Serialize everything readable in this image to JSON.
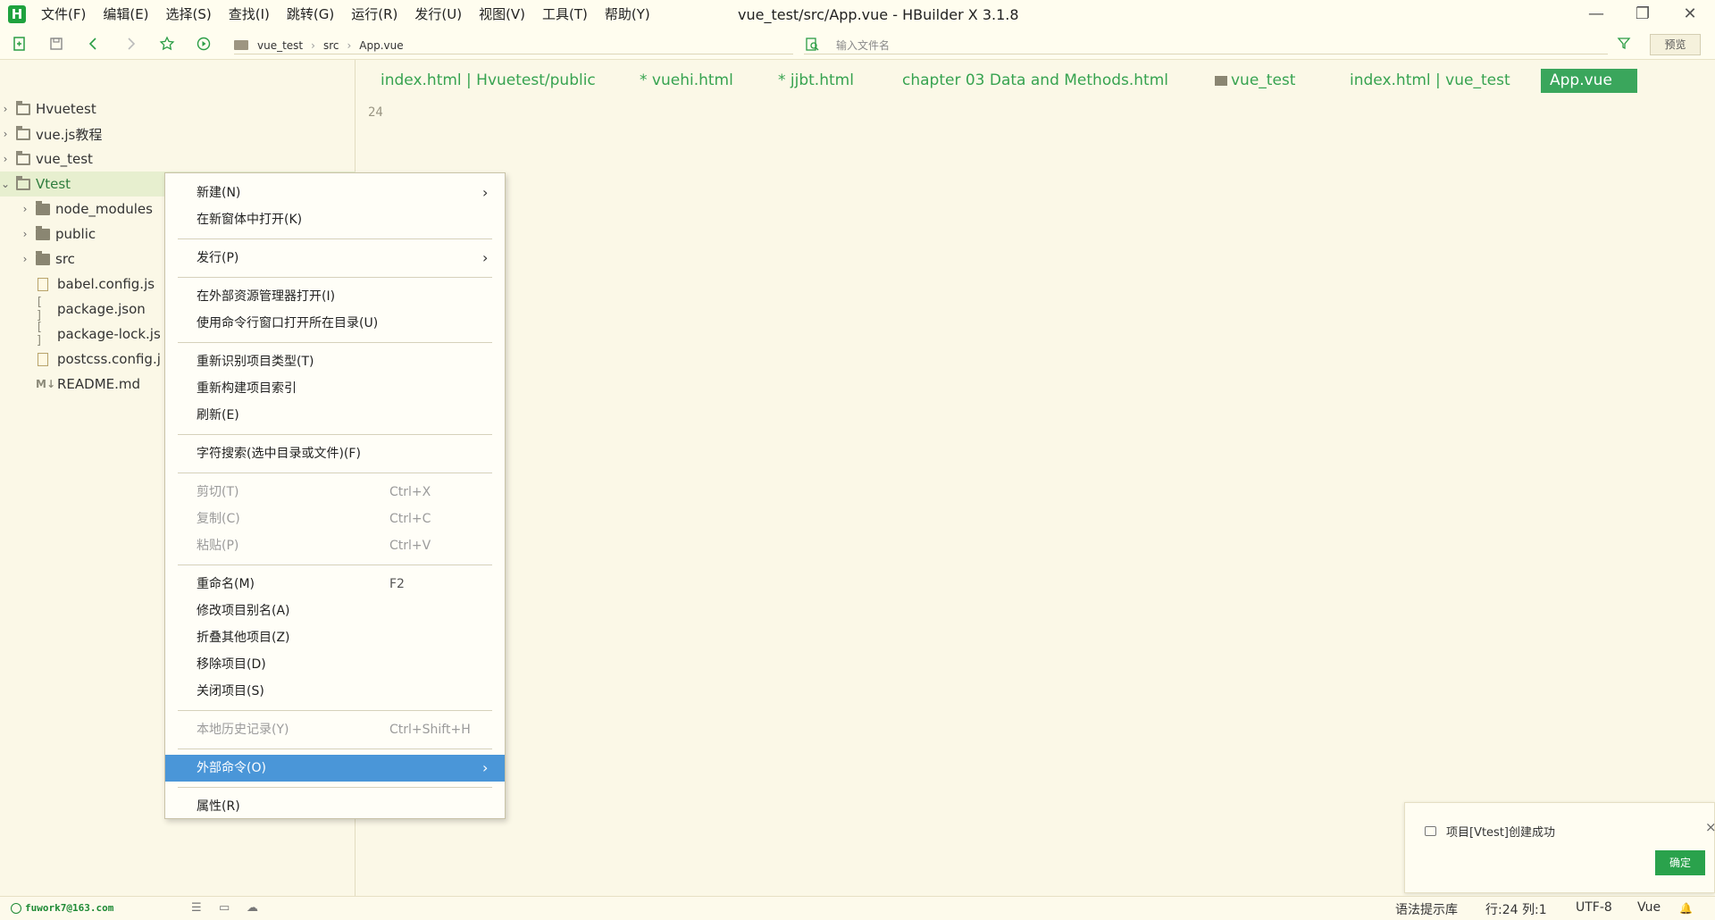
{
  "app": {
    "window_title": "vue_test/src/App.vue - HBuilder X 3.1.8",
    "logo_letter": "H"
  },
  "menu": [
    "文件(F)",
    "编辑(E)",
    "选择(S)",
    "查找(I)",
    "跳转(G)",
    "运行(R)",
    "发行(U)",
    "视图(V)",
    "工具(T)",
    "帮助(Y)"
  ],
  "window_controls": {
    "minimize": "—",
    "maximize": "❐",
    "close": "✕"
  },
  "toolbar": {
    "breadcrumb": [
      "vue_test",
      "src",
      "App.vue"
    ],
    "breadcrumb_sep": "›",
    "file_search_placeholder": "输入文件名",
    "preview_label": "预览"
  },
  "project_tree": [
    {
      "label": "Hvuetest",
      "arrow": "›",
      "type": "project"
    },
    {
      "label": "vue.js教程",
      "arrow": "›",
      "type": "project"
    },
    {
      "label": "vue_test",
      "arrow": "›",
      "type": "project"
    },
    {
      "label": "Vtest",
      "arrow": "⌄",
      "type": "project",
      "selected": true
    },
    {
      "label": "node_modules",
      "arrow": "›",
      "type": "folder"
    },
    {
      "label": "public",
      "arrow": "›",
      "type": "folder"
    },
    {
      "label": "src",
      "arrow": "›",
      "type": "folder"
    },
    {
      "label": "babel.config.js",
      "arrow": "",
      "type": "js"
    },
    {
      "label": "package.json",
      "arrow": "",
      "type": "json"
    },
    {
      "label": "package-lock.js",
      "arrow": "",
      "type": "json"
    },
    {
      "label": "postcss.config.j",
      "arrow": "",
      "type": "js"
    },
    {
      "label": "README.md",
      "arrow": "",
      "type": "md"
    }
  ],
  "tabs": [
    {
      "label": "index.html | Hvuetest/public",
      "active": false
    },
    {
      "label": "* vuehi.html",
      "active": false
    },
    {
      "label": "* jjbt.html",
      "active": false
    },
    {
      "label": "chapter 03 Data and Methods.html",
      "active": false
    },
    {
      "label": "vue_test",
      "active": false,
      "folder": true
    },
    {
      "label": "index.html | vue_test",
      "active": false
    },
    {
      "label": "App.vue",
      "active": true
    }
  ],
  "editor": {
    "line_number": "24"
  },
  "context_menu": {
    "items": [
      {
        "label": "新建(N)",
        "arrow": "›"
      },
      {
        "label": "在新窗体中打开(K)"
      },
      {
        "separator": true
      },
      {
        "label": "发行(P)",
        "arrow": "›"
      },
      {
        "separator": true
      },
      {
        "label": "在外部资源管理器打开(I)"
      },
      {
        "label": "使用命令行窗口打开所在目录(U)"
      },
      {
        "separator": true
      },
      {
        "label": "重新识别项目类型(T)"
      },
      {
        "label": "重新构建项目索引"
      },
      {
        "label": "刷新(E)"
      },
      {
        "separator": true
      },
      {
        "label": "字符搜索(选中目录或文件)(F)"
      },
      {
        "separator": true
      },
      {
        "label": "剪切(T)",
        "shortcut": "Ctrl+X",
        "disabled": true
      },
      {
        "label": "复制(C)",
        "shortcut": "Ctrl+C",
        "disabled": true
      },
      {
        "label": "粘贴(P)",
        "shortcut": "Ctrl+V",
        "disabled": true
      },
      {
        "separator": true
      },
      {
        "label": "重命名(M)",
        "shortcut": "F2"
      },
      {
        "label": "修改项目别名(A)"
      },
      {
        "label": "折叠其他项目(Z)"
      },
      {
        "label": "移除项目(D)"
      },
      {
        "label": "关闭项目(S)"
      },
      {
        "separator": true
      },
      {
        "label": "本地历史记录(Y)",
        "shortcut": "Ctrl+Shift+H",
        "disabled": true
      },
      {
        "separator": true
      },
      {
        "label": "外部命令(O)",
        "arrow": "›",
        "highlighted": true
      },
      {
        "separator": true
      },
      {
        "label": "属性(R)"
      }
    ]
  },
  "notification": {
    "message": "项目[Vtest]创建成功",
    "ok_label": "确定",
    "close": "×"
  },
  "statusbar": {
    "account": "fuwork7@163.com",
    "syntax_lib": "语法提示库",
    "position": "行:24  列:1",
    "encoding": "UTF-8",
    "language": "Vue",
    "bell": "🔔"
  },
  "colors": {
    "background": "#fbf8e7",
    "accent_green": "#3aa65c",
    "menu_highlight": "#4a96d8"
  }
}
